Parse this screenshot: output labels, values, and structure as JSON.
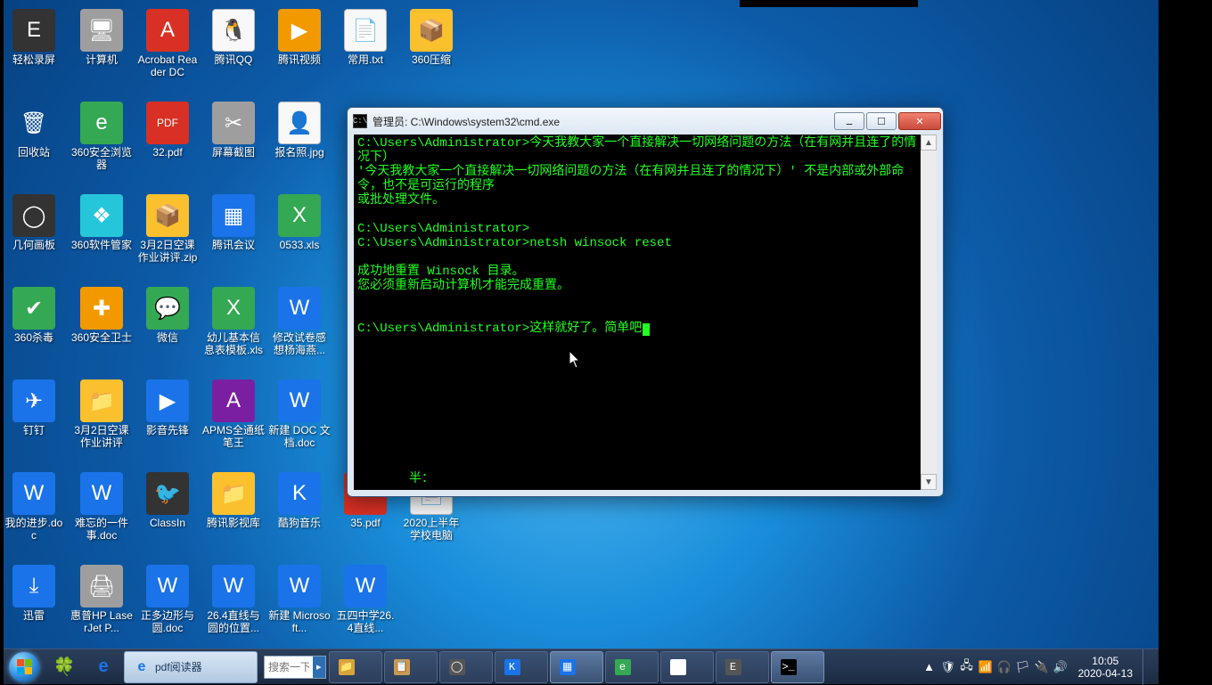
{
  "cmd": {
    "title": "管理员: C:\\Windows\\system32\\cmd.exe",
    "icon": "C:\\",
    "lines": [
      "C:\\Users\\Administrator>今天我教大家一个直接解决一切网络问题の方法（在有网并且连了的情况下）",
      "'今天我教大家一个直接解决一切网络问题の方法（在有网并且连了的情况下）' 不是内部或外部命令，也不是可运行的程序",
      "或批处理文件。",
      "",
      "C:\\Users\\Administrator>",
      "C:\\Users\\Administrator>netsh winsock reset",
      "",
      "成功地重置 Winsock 目录。",
      "您必须重新启动计算机才能完成重置。",
      "",
      "",
      "C:\\Users\\Administrator>这样就好了。简单吧"
    ],
    "bottom_caption": "半："
  },
  "desktop_icons": [
    {
      "row": 0,
      "col": 0,
      "label": "轻松录屏",
      "cls": "ic-dark",
      "glyph": "E"
    },
    {
      "row": 0,
      "col": 1,
      "label": "计算机",
      "cls": "ic-grey",
      "glyph": "🖥"
    },
    {
      "row": 0,
      "col": 2,
      "label": "Acrobat Reader DC",
      "cls": "ic-red",
      "glyph": "A"
    },
    {
      "row": 0,
      "col": 3,
      "label": "腾讯QQ",
      "cls": "ic-white",
      "glyph": "🐧"
    },
    {
      "row": 0,
      "col": 4,
      "label": "腾讯视频",
      "cls": "ic-orange",
      "glyph": "▶"
    },
    {
      "row": 0,
      "col": 5,
      "label": "常用.txt",
      "cls": "ic-white",
      "glyph": "📄"
    },
    {
      "row": 0,
      "col": 6,
      "label": "360压缩",
      "cls": "ic-yellow",
      "glyph": "📦"
    },
    {
      "row": 1,
      "col": 0,
      "label": "回收站",
      "cls": "",
      "glyph": "🗑"
    },
    {
      "row": 1,
      "col": 1,
      "label": "360安全浏览器",
      "cls": "ic-green",
      "glyph": "e"
    },
    {
      "row": 1,
      "col": 2,
      "label": "32.pdf",
      "cls": "ic-red",
      "glyph": "PDF"
    },
    {
      "row": 1,
      "col": 3,
      "label": "屏幕截图",
      "cls": "ic-grey",
      "glyph": "✂"
    },
    {
      "row": 1,
      "col": 4,
      "label": "报名照.jpg",
      "cls": "ic-white",
      "glyph": "👤"
    },
    {
      "row": 2,
      "col": 0,
      "label": "几何画板",
      "cls": "ic-dark",
      "glyph": "◯"
    },
    {
      "row": 2,
      "col": 1,
      "label": "360软件管家",
      "cls": "ic-cyan",
      "glyph": "❖"
    },
    {
      "row": 2,
      "col": 2,
      "label": "3月2日空课作业讲评.zip",
      "cls": "ic-yellow",
      "glyph": "📦"
    },
    {
      "row": 2,
      "col": 3,
      "label": "腾讯会议",
      "cls": "ic-blue",
      "glyph": "▦"
    },
    {
      "row": 2,
      "col": 4,
      "label": "0533.xls",
      "cls": "ic-green",
      "glyph": "X"
    },
    {
      "row": 3,
      "col": 0,
      "label": "360杀毒",
      "cls": "ic-green",
      "glyph": "✔"
    },
    {
      "row": 3,
      "col": 1,
      "label": "360安全卫士",
      "cls": "ic-orange",
      "glyph": "✚"
    },
    {
      "row": 3,
      "col": 2,
      "label": "微信",
      "cls": "ic-green",
      "glyph": "💬"
    },
    {
      "row": 3,
      "col": 3,
      "label": "幼儿基本信息表模板.xls",
      "cls": "ic-green",
      "glyph": "X"
    },
    {
      "row": 3,
      "col": 4,
      "label": "修改试卷感想杨海燕...",
      "cls": "ic-blue",
      "glyph": "W"
    },
    {
      "row": 4,
      "col": 0,
      "label": "钉钉",
      "cls": "ic-blue",
      "glyph": "✈"
    },
    {
      "row": 4,
      "col": 1,
      "label": "3月2日空课作业讲评",
      "cls": "ic-yellow",
      "glyph": "📁"
    },
    {
      "row": 4,
      "col": 2,
      "label": "影音先锋",
      "cls": "ic-blue",
      "glyph": "▶"
    },
    {
      "row": 4,
      "col": 3,
      "label": "APMS全通纸笔王",
      "cls": "ic-purple",
      "glyph": "A"
    },
    {
      "row": 4,
      "col": 4,
      "label": "新建 DOC 文档.doc",
      "cls": "ic-blue",
      "glyph": "W"
    },
    {
      "row": 5,
      "col": 0,
      "label": "我的进步.doc",
      "cls": "ic-blue",
      "glyph": "W"
    },
    {
      "row": 5,
      "col": 1,
      "label": "难忘的一件事.doc",
      "cls": "ic-blue",
      "glyph": "W"
    },
    {
      "row": 5,
      "col": 2,
      "label": "ClassIn",
      "cls": "ic-dark",
      "glyph": "🐦"
    },
    {
      "row": 5,
      "col": 3,
      "label": "腾讯影视库",
      "cls": "ic-yellow",
      "glyph": "📁"
    },
    {
      "row": 5,
      "col": 4,
      "label": "酷狗音乐",
      "cls": "ic-blue",
      "glyph": "K"
    },
    {
      "row": 5,
      "col": 5,
      "label": "35.pdf",
      "cls": "ic-red",
      "glyph": "PDF"
    },
    {
      "row": 5,
      "col": 6,
      "label": "2020上半年学校电脑",
      "cls": "ic-white",
      "glyph": "📄"
    },
    {
      "row": 6,
      "col": 0,
      "label": "迅雷",
      "cls": "ic-blue",
      "glyph": "⤓"
    },
    {
      "row": 6,
      "col": 1,
      "label": "惠普HP LaserJet P...",
      "cls": "ic-grey",
      "glyph": "🖨"
    },
    {
      "row": 6,
      "col": 2,
      "label": "正多边形与圆.doc",
      "cls": "ic-blue",
      "glyph": "W"
    },
    {
      "row": 6,
      "col": 3,
      "label": "26.4直线与圆的位置...",
      "cls": "ic-blue",
      "glyph": "W"
    },
    {
      "row": 6,
      "col": 4,
      "label": "新建 Microsoft...",
      "cls": "ic-blue",
      "glyph": "W"
    },
    {
      "row": 6,
      "col": 5,
      "label": "五四中学26.4直线...",
      "cls": "ic-blue",
      "glyph": "W"
    }
  ],
  "taskbar": {
    "search_placeholder": "搜索一下",
    "ie_task": "pdf阅读器",
    "tray_time": "10:05",
    "tray_date": "2020-04-13",
    "pinned": [
      {
        "name": "clover",
        "glyph": "🍀",
        "color": "#7cb342"
      },
      {
        "name": "ie",
        "glyph": "e",
        "color": "#1a73e8"
      }
    ],
    "tasks": [
      {
        "name": "folder",
        "glyph": "📁",
        "bg": "#d8a33a"
      },
      {
        "name": "notes",
        "glyph": "📋",
        "bg": "#c79b53"
      },
      {
        "name": "chrome",
        "glyph": "◯",
        "bg": "#555"
      },
      {
        "name": "kugou",
        "glyph": "K",
        "bg": "#1a73e8"
      },
      {
        "name": "meeting",
        "glyph": "▦",
        "bg": "#1a73e8",
        "active": true
      },
      {
        "name": "360",
        "glyph": "e",
        "bg": "#34a853"
      },
      {
        "name": "app",
        "glyph": "◫",
        "bg": "#fff"
      },
      {
        "name": "rec",
        "glyph": "E",
        "bg": "#555"
      },
      {
        "name": "cmd",
        "glyph": ">_",
        "bg": "#000",
        "active": true
      }
    ],
    "tray_icons": [
      "▲",
      "🛡",
      "🖧",
      "📶",
      "🎧",
      "🏳",
      "🔌",
      "🔊"
    ]
  }
}
